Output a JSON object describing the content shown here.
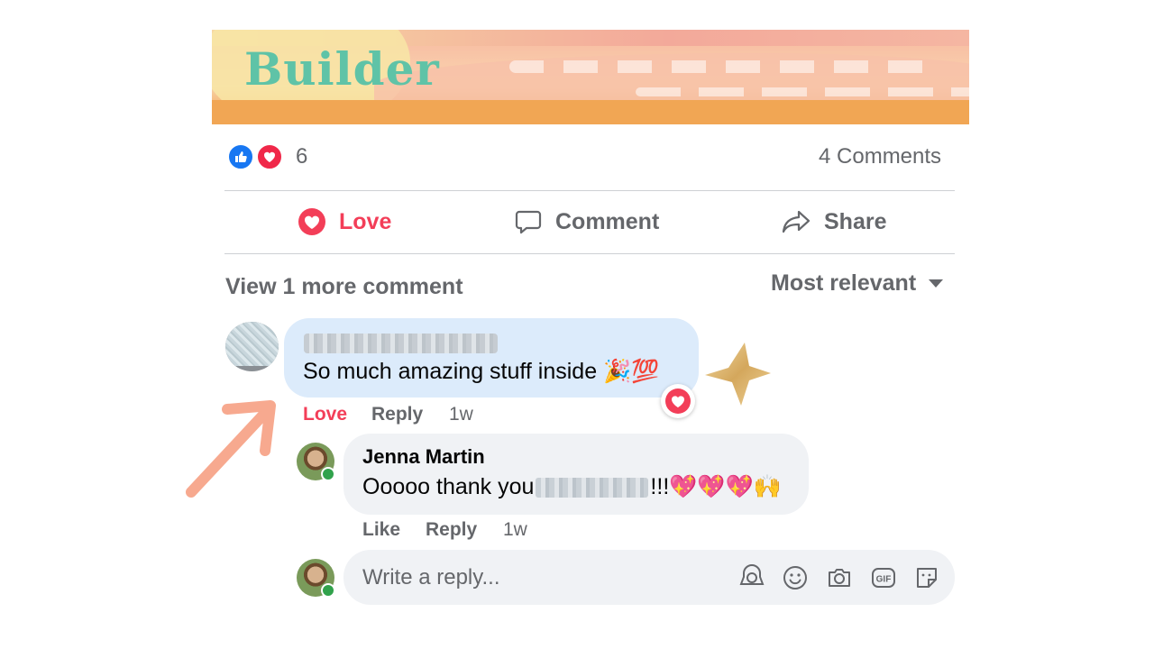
{
  "banner": {
    "title": "Builder"
  },
  "stats": {
    "reaction_count": "6",
    "comments_count": "4 Comments"
  },
  "actions": {
    "love": "Love",
    "comment": "Comment",
    "share": "Share"
  },
  "comments_header": {
    "view_more": "View 1 more comment",
    "sort": "Most relevant"
  },
  "comment1": {
    "text": "So much amazing stuff inside 🎉💯",
    "love": "Love",
    "reply": "Reply",
    "time": "1w"
  },
  "comment2": {
    "author": "Jenna Martin",
    "text_before": "Ooooo thank you",
    "text_after": "!!!💖💖💖🙌",
    "like": "Like",
    "reply": "Reply",
    "time": "1w"
  },
  "reply_box": {
    "placeholder": "Write a reply..."
  },
  "colors": {
    "love_red": "#f33e58",
    "like_blue": "#1877f2",
    "muted": "#65676b",
    "bubble_blue": "#dcebfb",
    "bubble_gray": "#f0f2f5",
    "arrow": "#f7a98f",
    "star": "#d9b36a"
  },
  "icons": [
    "like-reaction-icon",
    "love-reaction-icon",
    "heart-icon",
    "comment-icon",
    "share-icon",
    "sort-caret-icon",
    "star-sticker-icon",
    "annotation-arrow-icon",
    "avatar-sticker-icon",
    "emoji-icon",
    "camera-icon",
    "gif-icon",
    "sticker-icon"
  ]
}
